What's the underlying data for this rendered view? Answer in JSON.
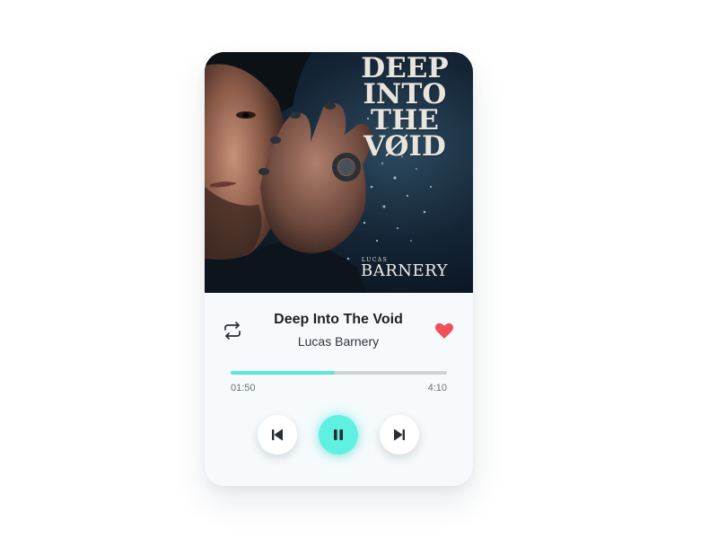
{
  "album": {
    "cover_title_lines": [
      "DEEP",
      "INTO",
      "THE",
      "VØID"
    ],
    "cover_artist_first": "LUCAS",
    "cover_artist_last": "BARNERY"
  },
  "track": {
    "title": "Deep Into The Void",
    "artist": "Lucas Barnery",
    "liked": true
  },
  "playback": {
    "elapsed": "01:50",
    "duration": "4:10",
    "progress": 0.48,
    "state": "playing"
  },
  "colors": {
    "accent": "#5ff0e2",
    "progress_fill": "#5ee6dd",
    "heart": "#f0505a",
    "card_bg": "#f6fafc"
  },
  "icons": {
    "repeat": "repeat-icon",
    "heart": "heart-icon",
    "previous": "skip-previous-icon",
    "play_pause": "pause-icon",
    "next": "skip-next-icon"
  }
}
